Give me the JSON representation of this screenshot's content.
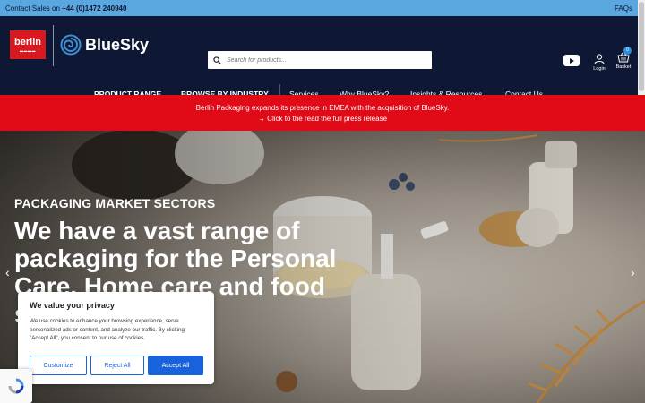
{
  "topbar": {
    "contact_prefix": "Contact Sales on",
    "phone": "+44 (0)1472 240940",
    "faqs": "FAQs"
  },
  "header": {
    "logo_berlin": "berlin",
    "logo_bluesky": "BlueSky",
    "search_placeholder": "Search for products...",
    "login_label": "Login",
    "basket_label": "Basket",
    "basket_count": "0"
  },
  "nav": [
    {
      "label": "PRODUCT RANGE"
    },
    {
      "label": "BROWSE BY INDUSTRY"
    },
    {
      "label": "Services"
    },
    {
      "label": "Why BlueSky?"
    },
    {
      "label": "Insights & Resources"
    },
    {
      "label": "Contact Us"
    }
  ],
  "banner": {
    "line1": "Berlin Packaging expands its presence in EMEA with the acquisition of BlueSky.",
    "line2": "→ Click to the read the full press release"
  },
  "hero": {
    "kicker": "PACKAGING MARKET SECTORS",
    "headline": "We have a vast range of packaging for the Personal Care, Home care and food sectors.",
    "prev": "‹",
    "next": "›"
  },
  "cookie": {
    "title": "We value your privacy",
    "body": "We use cookies to enhance your browsing experience, serve personalized ads or content, and analyze our traffic. By clicking \"Accept All\", you consent to our use of cookies.",
    "customize": "Customize",
    "reject": "Reject All",
    "accept": "Accept All"
  },
  "colors": {
    "topbar": "#5aa6df",
    "header": "#0e1834",
    "banner": "#e10b17",
    "cookie_accent": "#1863dc"
  }
}
